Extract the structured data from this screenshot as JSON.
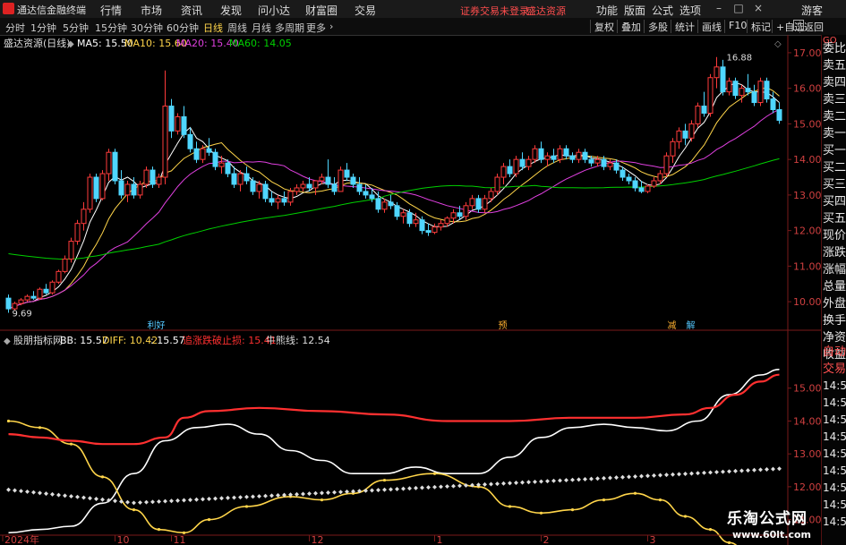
{
  "app": {
    "title": "通达信金融终端",
    "menu": [
      "行情",
      "市场",
      "资讯",
      "发现",
      "问小达",
      "财富圈",
      "交易"
    ],
    "notice": "证券交易未登录",
    "stock_link": "盛达资源",
    "right_menu": [
      "功能",
      "版面",
      "公式",
      "选项"
    ],
    "guest": "游客"
  },
  "periods": {
    "items": [
      "分时",
      "1分钟",
      "5分钟",
      "15分钟",
      "30分钟",
      "60分钟",
      "日线",
      "周线",
      "月线",
      "多周期",
      "更多"
    ],
    "active": "日线"
  },
  "tools": {
    "items": [
      "复权",
      "叠加",
      "多股",
      "统计",
      "画线",
      "F10",
      "标记",
      "+自选",
      "返回"
    ]
  },
  "main_legend": {
    "stock": "盛达资源(日线)",
    "ma": [
      {
        "label": "MA5: 15.50",
        "color": "#ffffff"
      },
      {
        "label": "MA10: 15.60",
        "color": "#ffd54a"
      },
      {
        "label": "MA20: 15.40",
        "color": "#e040e0"
      },
      {
        "label": "MA60: 14.05",
        "color": "#00d000"
      }
    ]
  },
  "sub_legend": {
    "name": "股朋指标网",
    "items": [
      {
        "label": "BB: 15.57",
        "color": "#ffffff"
      },
      {
        "label": "DIFF: 10.42",
        "color": "#ffd54a"
      },
      {
        "label": ": 15.57",
        "color": "#ffffff"
      },
      {
        "label": "追涨跌破止损: 15.41",
        "color": "#ff3030"
      },
      {
        "label": "牛熊线: 12.54",
        "color": "#dddddd"
      }
    ]
  },
  "side_panel": {
    "top_label": "GO",
    "items": [
      "委比",
      "卖五",
      "卖四",
      "卖三",
      "卖二",
      "卖一",
      "买一",
      "买二",
      "买三",
      "买四",
      "买五",
      "现价",
      "涨跌",
      "涨幅",
      "总量",
      "外盘",
      "换手",
      "净资",
      "收益"
    ],
    "sub_items": [
      "自动",
      "交易",
      "14:56",
      "14:56",
      "14:56",
      "14:56",
      "14:56",
      "14:56",
      "14:56",
      "14:56",
      "14:56"
    ]
  },
  "chart_data": [
    {
      "type": "candlestick",
      "title": "盛达资源(日线)",
      "ylim": [
        9.5,
        17.3
      ],
      "yticks": [
        "17.00",
        "16.00",
        "15.00",
        "14.00",
        "13.00",
        "12.00",
        "11.00",
        "10.00"
      ],
      "ohlc": [
        [
          10.1,
          10.2,
          9.69,
          9.8
        ],
        [
          9.8,
          10.0,
          9.75,
          9.95
        ],
        [
          9.95,
          10.1,
          9.9,
          10.05
        ],
        [
          10.05,
          10.2,
          10.0,
          10.15
        ],
        [
          10.15,
          10.3,
          10.05,
          10.1
        ],
        [
          10.1,
          10.4,
          10.05,
          10.35
        ],
        [
          10.35,
          10.5,
          10.2,
          10.25
        ],
        [
          10.25,
          10.6,
          10.2,
          10.55
        ],
        [
          10.55,
          10.9,
          10.5,
          10.85
        ],
        [
          10.85,
          11.3,
          10.8,
          11.2
        ],
        [
          11.2,
          11.8,
          11.1,
          11.7
        ],
        [
          11.7,
          12.3,
          11.6,
          12.2
        ],
        [
          12.2,
          12.8,
          12.0,
          12.6
        ],
        [
          12.6,
          13.6,
          12.5,
          13.5
        ],
        [
          13.5,
          13.6,
          12.8,
          12.9
        ],
        [
          12.9,
          13.7,
          12.85,
          13.6
        ],
        [
          13.6,
          14.3,
          13.4,
          14.2
        ],
        [
          14.2,
          14.3,
          13.3,
          13.4
        ],
        [
          13.4,
          13.7,
          12.9,
          13.0
        ],
        [
          13.0,
          13.4,
          12.8,
          13.3
        ],
        [
          13.3,
          13.5,
          12.9,
          13.0
        ],
        [
          13.0,
          13.4,
          12.9,
          13.3
        ],
        [
          13.3,
          13.8,
          13.2,
          13.7
        ],
        [
          13.7,
          13.8,
          13.2,
          13.3
        ],
        [
          13.3,
          13.6,
          13.2,
          13.5
        ],
        [
          13.5,
          16.5,
          13.3,
          15.5
        ],
        [
          15.5,
          15.7,
          14.6,
          14.8
        ],
        [
          14.8,
          15.3,
          14.7,
          15.2
        ],
        [
          15.2,
          15.5,
          14.6,
          14.7
        ],
        [
          14.7,
          14.9,
          14.2,
          14.3
        ],
        [
          14.3,
          14.5,
          13.9,
          14.0
        ],
        [
          14.0,
          14.4,
          13.9,
          14.3
        ],
        [
          14.3,
          14.6,
          14.1,
          14.2
        ],
        [
          14.2,
          14.3,
          13.7,
          13.8
        ],
        [
          13.8,
          14.1,
          13.6,
          13.9
        ],
        [
          13.9,
          14.0,
          13.5,
          13.6
        ],
        [
          13.6,
          13.8,
          13.2,
          13.3
        ],
        [
          13.3,
          13.7,
          13.1,
          13.6
        ],
        [
          13.6,
          13.8,
          13.3,
          13.4
        ],
        [
          13.4,
          13.5,
          13.0,
          13.1
        ],
        [
          13.1,
          13.4,
          12.9,
          13.3
        ],
        [
          13.3,
          13.4,
          12.8,
          12.9
        ],
        [
          12.9,
          13.1,
          12.7,
          12.8
        ],
        [
          12.8,
          13.0,
          12.6,
          12.9
        ],
        [
          12.9,
          13.1,
          12.7,
          12.8
        ],
        [
          12.8,
          13.2,
          12.7,
          13.1
        ],
        [
          13.1,
          13.3,
          13.0,
          13.2
        ],
        [
          13.2,
          13.4,
          13.1,
          13.3
        ],
        [
          13.3,
          13.5,
          13.1,
          13.2
        ],
        [
          13.2,
          13.4,
          13.0,
          13.4
        ],
        [
          13.4,
          13.6,
          13.3,
          13.5
        ],
        [
          13.5,
          14.0,
          13.2,
          13.3
        ],
        [
          13.3,
          13.5,
          13.0,
          13.1
        ],
        [
          13.1,
          13.8,
          13.1,
          13.7
        ],
        [
          13.7,
          13.9,
          13.4,
          13.5
        ],
        [
          13.5,
          13.6,
          13.2,
          13.3
        ],
        [
          13.3,
          13.5,
          13.0,
          13.1
        ],
        [
          13.1,
          13.3,
          12.9,
          13.0
        ],
        [
          13.0,
          13.2,
          12.8,
          12.9
        ],
        [
          12.9,
          13.1,
          12.5,
          12.6
        ],
        [
          12.6,
          12.9,
          12.5,
          12.8
        ],
        [
          12.8,
          13.0,
          12.6,
          12.7
        ],
        [
          12.7,
          12.8,
          12.3,
          12.4
        ],
        [
          12.4,
          12.6,
          12.2,
          12.5
        ],
        [
          12.5,
          12.6,
          12.1,
          12.2
        ],
        [
          12.2,
          12.5,
          12.1,
          12.3
        ],
        [
          12.3,
          12.4,
          11.9,
          12.0
        ],
        [
          12.0,
          12.2,
          11.85,
          11.95
        ],
        [
          11.95,
          12.2,
          11.9,
          12.1
        ],
        [
          12.1,
          12.3,
          12.0,
          12.2
        ],
        [
          12.2,
          12.4,
          12.1,
          12.35
        ],
        [
          12.35,
          12.6,
          12.2,
          12.5
        ],
        [
          12.5,
          12.7,
          12.3,
          12.4
        ],
        [
          12.4,
          12.8,
          12.3,
          12.7
        ],
        [
          12.7,
          13.0,
          12.6,
          12.9
        ],
        [
          12.9,
          13.0,
          12.5,
          12.6
        ],
        [
          12.6,
          13.0,
          12.5,
          12.9
        ],
        [
          12.9,
          13.2,
          12.8,
          13.1
        ],
        [
          13.1,
          13.6,
          13.0,
          13.5
        ],
        [
          13.5,
          13.9,
          13.3,
          13.8
        ],
        [
          13.8,
          14.0,
          13.5,
          13.6
        ],
        [
          13.6,
          14.1,
          13.5,
          14.0
        ],
        [
          14.0,
          14.2,
          13.7,
          13.8
        ],
        [
          13.8,
          14.1,
          13.7,
          14.0
        ],
        [
          14.0,
          14.4,
          13.9,
          14.3
        ],
        [
          14.3,
          14.5,
          13.9,
          14.0
        ],
        [
          14.0,
          14.2,
          13.8,
          14.1
        ],
        [
          14.1,
          14.3,
          13.9,
          14.0
        ],
        [
          14.0,
          14.4,
          13.9,
          14.3
        ],
        [
          14.3,
          14.4,
          14.0,
          14.1
        ],
        [
          14.1,
          14.2,
          13.9,
          14.0
        ],
        [
          14.0,
          14.3,
          13.9,
          14.2
        ],
        [
          14.2,
          14.3,
          13.9,
          14.0
        ],
        [
          14.0,
          14.1,
          13.8,
          13.9
        ],
        [
          13.9,
          14.1,
          13.8,
          14.0
        ],
        [
          14.0,
          14.1,
          13.7,
          13.8
        ],
        [
          13.8,
          14.0,
          13.7,
          13.9
        ],
        [
          13.9,
          14.0,
          13.6,
          13.7
        ],
        [
          13.7,
          13.8,
          13.4,
          13.5
        ],
        [
          13.5,
          13.6,
          13.3,
          13.4
        ],
        [
          13.4,
          13.5,
          13.1,
          13.2
        ],
        [
          13.2,
          13.4,
          13.05,
          13.1
        ],
        [
          13.1,
          13.3,
          13.05,
          13.25
        ],
        [
          13.25,
          13.5,
          13.2,
          13.4
        ],
        [
          13.4,
          13.7,
          13.3,
          13.6
        ],
        [
          13.6,
          14.2,
          13.5,
          14.1
        ],
        [
          14.1,
          14.6,
          13.9,
          14.5
        ],
        [
          14.5,
          14.9,
          14.3,
          14.8
        ],
        [
          14.8,
          15.0,
          14.4,
          14.6
        ],
        [
          14.6,
          15.1,
          14.5,
          15.0
        ],
        [
          15.0,
          15.6,
          14.9,
          15.5
        ],
        [
          15.5,
          15.9,
          15.2,
          15.3
        ],
        [
          15.3,
          16.4,
          15.2,
          16.3
        ],
        [
          16.3,
          16.88,
          16.0,
          16.6
        ],
        [
          16.6,
          16.8,
          15.8,
          15.9
        ],
        [
          15.9,
          16.3,
          15.8,
          16.2
        ],
        [
          16.2,
          16.3,
          15.7,
          15.8
        ],
        [
          15.8,
          16.1,
          15.6,
          16.0
        ],
        [
          16.0,
          16.4,
          15.8,
          15.9
        ],
        [
          15.9,
          16.1,
          15.5,
          15.6
        ],
        [
          15.6,
          16.3,
          15.5,
          16.2
        ],
        [
          16.2,
          16.3,
          15.6,
          15.7
        ],
        [
          15.7,
          15.9,
          15.3,
          15.4
        ],
        [
          15.4,
          15.6,
          15.0,
          15.1
        ]
      ],
      "ma_colors": {
        "MA5": "#ffffff",
        "MA10": "#ffd54a",
        "MA20": "#e040e0",
        "MA60": "#00d000"
      },
      "ma60_start": 11.35,
      "annotations": [
        {
          "text": "16.88",
          "x": 114,
          "y": 16.88
        },
        {
          "text": "9.69",
          "x": 0,
          "y": 9.69
        }
      ],
      "markers": [
        {
          "x": 23,
          "text": "利好",
          "color": "#55c8ff"
        },
        {
          "x": 79,
          "text": "预",
          "color": "#ffb030"
        },
        {
          "x": 106,
          "text": "减",
          "color": "#ffb030"
        },
        {
          "x": 109,
          "text": "解",
          "color": "#55c8ff"
        }
      ]
    },
    {
      "type": "line",
      "title": "股朋指标网",
      "ylim": [
        10.5,
        16.0
      ],
      "yticks": [
        "15.00",
        "14.00",
        "13.00",
        "12.00",
        "11.00"
      ],
      "x_labels": [
        {
          "text": "2024年",
          "x": 0
        },
        {
          "text": "10",
          "x": 17
        },
        {
          "text": "11",
          "x": 26
        },
        {
          "text": "12",
          "x": 48
        },
        {
          "text": "1",
          "x": 68
        },
        {
          "text": "2",
          "x": 85
        },
        {
          "text": "3",
          "x": 102
        }
      ],
      "series": [
        {
          "name": "BB",
          "color": "#ffffff",
          "points": [
            [
              0,
              10.6
            ],
            [
              5,
              10.7
            ],
            [
              10,
              10.8
            ],
            [
              15,
              11.5
            ],
            [
              20,
              12.4
            ],
            [
              25,
              13.4
            ],
            [
              30,
              13.8
            ],
            [
              35,
              13.9
            ],
            [
              40,
              13.6
            ],
            [
              45,
              13.1
            ],
            [
              50,
              12.8
            ],
            [
              55,
              12.4
            ],
            [
              60,
              12.4
            ],
            [
              65,
              12.6
            ],
            [
              70,
              12.4
            ],
            [
              75,
              12.4
            ],
            [
              80,
              12.9
            ],
            [
              85,
              13.5
            ],
            [
              90,
              13.8
            ],
            [
              95,
              13.9
            ],
            [
              100,
              13.8
            ],
            [
              105,
              13.7
            ],
            [
              110,
              14.0
            ],
            [
              115,
              14.8
            ],
            [
              120,
              15.4
            ],
            [
              123,
              15.57
            ]
          ]
        },
        {
          "name": "DIFF",
          "color": "#ffd54a",
          "points": [
            [
              0,
              14.0
            ],
            [
              5,
              13.8
            ],
            [
              10,
              13.3
            ],
            [
              15,
              12.3
            ],
            [
              20,
              11.3
            ],
            [
              24,
              10.7
            ],
            [
              28,
              10.6
            ],
            [
              32,
              11.0
            ],
            [
              38,
              11.4
            ],
            [
              45,
              11.7
            ],
            [
              50,
              11.6
            ],
            [
              55,
              11.8
            ],
            [
              60,
              12.2
            ],
            [
              68,
              12.4
            ],
            [
              75,
              12.0
            ],
            [
              80,
              11.4
            ],
            [
              85,
              11.2
            ],
            [
              90,
              11.3
            ],
            [
              95,
              11.6
            ],
            [
              100,
              11.8
            ],
            [
              104,
              11.6
            ],
            [
              108,
              11.1
            ],
            [
              112,
              10.7
            ],
            [
              115,
              10.3
            ],
            [
              118,
              10.0
            ],
            [
              121,
              9.6
            ]
          ]
        },
        {
          "name": "追涨跌破止损",
          "color": "#ff3030",
          "points": [
            [
              0,
              13.6
            ],
            [
              5,
              13.5
            ],
            [
              10,
              13.4
            ],
            [
              15,
              13.3
            ],
            [
              20,
              13.3
            ],
            [
              25,
              13.5
            ],
            [
              28,
              14.1
            ],
            [
              32,
              14.3
            ],
            [
              40,
              14.4
            ],
            [
              50,
              14.3
            ],
            [
              60,
              14.2
            ],
            [
              70,
              14.0
            ],
            [
              80,
              14.0
            ],
            [
              90,
              14.1
            ],
            [
              100,
              14.1
            ],
            [
              108,
              14.2
            ],
            [
              112,
              14.4
            ],
            [
              116,
              14.8
            ],
            [
              120,
              15.2
            ],
            [
              123,
              15.41
            ]
          ]
        },
        {
          "name": "牛熊线",
          "color": "#dddddd",
          "dotted": true,
          "points": [
            [
              0,
              11.9
            ],
            [
              20,
              11.5
            ],
            [
              40,
              11.7
            ],
            [
              60,
              11.9
            ],
            [
              80,
              12.1
            ],
            [
              100,
              12.3
            ],
            [
              123,
              12.54
            ]
          ]
        }
      ]
    }
  ],
  "watermark": {
    "main": "乐淘公式网",
    "url": "www.60lt.com"
  }
}
